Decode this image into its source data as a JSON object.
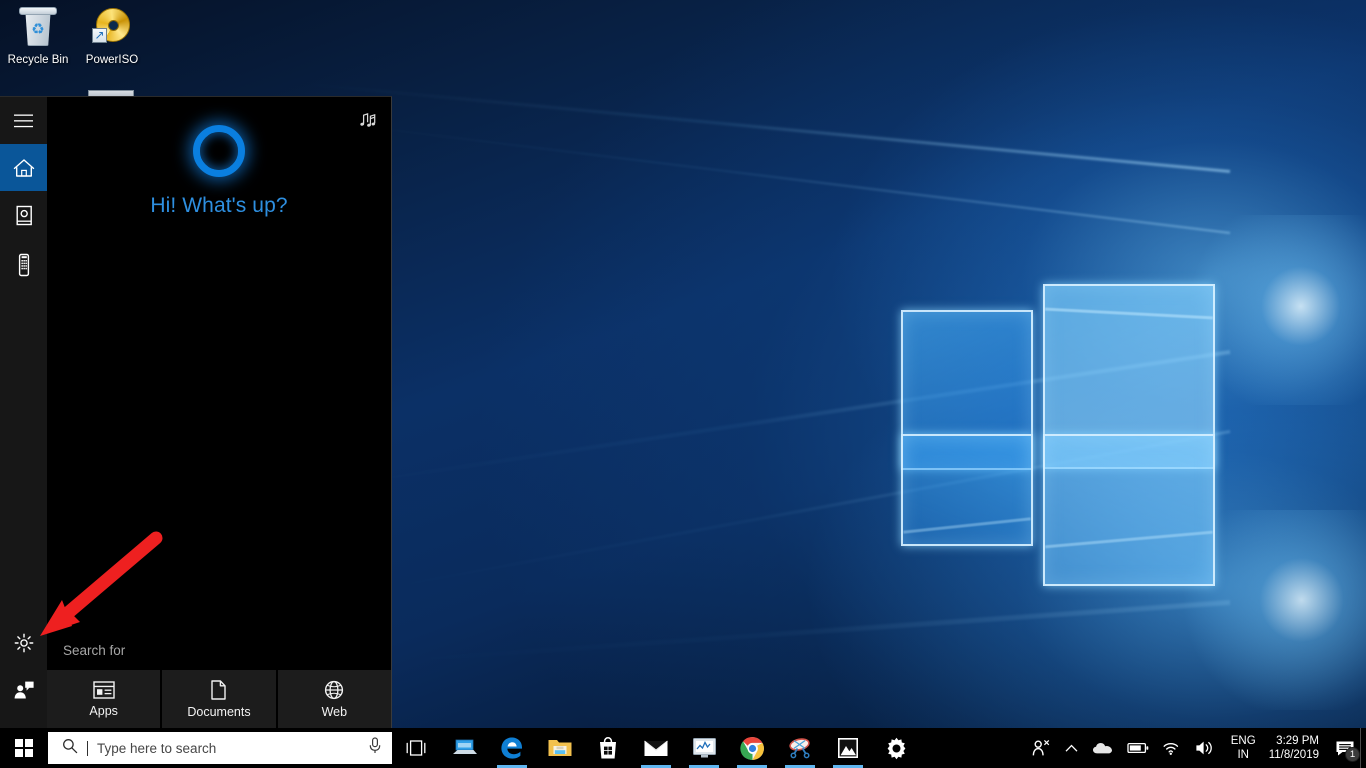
{
  "desktop": {
    "icons": [
      {
        "label": "Recycle Bin",
        "icon": "recycle-bin-icon"
      },
      {
        "label": "PowerISO",
        "icon": "poweriso-disc-icon"
      }
    ]
  },
  "cortana_panel": {
    "rail": {
      "menu_label": "Menu",
      "items": [
        {
          "name": "hamburger-menu",
          "icon": "hamburger-icon",
          "label": "Menu",
          "active": false
        },
        {
          "name": "home",
          "icon": "home-icon",
          "label": "Home",
          "active": true
        },
        {
          "name": "notebook",
          "icon": "notebook-icon",
          "label": "Notebook",
          "active": false
        },
        {
          "name": "devices",
          "icon": "device-icon",
          "label": "Devices",
          "active": false
        }
      ],
      "bottom_items": [
        {
          "name": "settings",
          "icon": "gear-icon",
          "label": "Settings"
        },
        {
          "name": "feedback",
          "icon": "feedback-person-icon",
          "label": "Feedback"
        }
      ]
    },
    "music_button_label": "Music",
    "greeting": "Hi! What's up?",
    "search_for_label": "Search for",
    "quick_tabs": [
      {
        "label": "Apps",
        "icon": "apps-window-icon"
      },
      {
        "label": "Documents",
        "icon": "document-page-icon"
      },
      {
        "label": "Web",
        "icon": "globe-icon"
      }
    ],
    "annotation": {
      "type": "red-arrow",
      "color": "#ee2020",
      "points_to": "settings"
    }
  },
  "taskbar": {
    "start_label": "Start",
    "search": {
      "placeholder": "Type here to search",
      "value": "",
      "search_icon": "search-icon",
      "mic_icon": "microphone-icon"
    },
    "apps": [
      {
        "name": "task-view",
        "icon": "task-view-icon",
        "label": "Task View",
        "running": false
      },
      {
        "name": "remote-desktop",
        "icon": "remote-desktop-icon",
        "label": "Remote Desktop",
        "running": false
      },
      {
        "name": "microsoft-edge",
        "icon": "edge-icon",
        "label": "Microsoft Edge",
        "running": false
      },
      {
        "name": "file-explorer",
        "icon": "folder-icon",
        "label": "File Explorer",
        "running": true
      },
      {
        "name": "microsoft-store",
        "icon": "store-bag-icon",
        "label": "Microsoft Store",
        "running": false
      },
      {
        "name": "mail",
        "icon": "mail-envelope-icon",
        "label": "Mail",
        "running": false
      },
      {
        "name": "task-manager",
        "icon": "monitor-chart-icon",
        "label": "Task Manager",
        "running": true
      },
      {
        "name": "google-chrome",
        "icon": "chrome-icon",
        "label": "Google Chrome",
        "running": true
      },
      {
        "name": "snipping-tool",
        "icon": "snipping-tool-icon",
        "label": "Snipping Tool",
        "running": true
      },
      {
        "name": "photos",
        "icon": "photos-icon",
        "label": "Photos",
        "running": true
      },
      {
        "name": "settings",
        "icon": "gear-icon",
        "label": "Settings",
        "running": true
      }
    ],
    "tray": {
      "people": {
        "icon": "people-icon",
        "label": "People"
      },
      "chevron": {
        "icon": "chevron-up-icon",
        "label": "Show hidden icons"
      },
      "onedrive": {
        "icon": "onedrive-cloud-icon",
        "label": "OneDrive"
      },
      "battery": {
        "icon": "battery-icon",
        "label": "Battery"
      },
      "network": {
        "icon": "wifi-icon",
        "label": "Network"
      },
      "volume": {
        "icon": "speaker-icon",
        "label": "Volume"
      },
      "language": {
        "line1": "ENG",
        "line2": "IN"
      },
      "clock": {
        "time": "3:29 PM",
        "date": "11/8/2019"
      },
      "action_center": {
        "icon": "action-center-icon",
        "label": "Notifications",
        "badge": "1"
      }
    }
  }
}
